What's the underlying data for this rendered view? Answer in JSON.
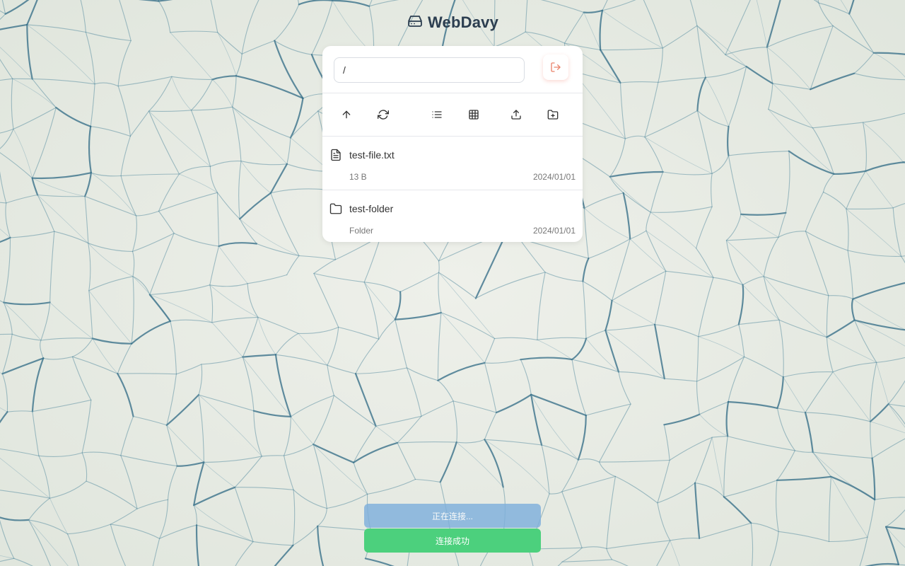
{
  "app": {
    "title": "WebDavy"
  },
  "path_bar": {
    "value": "/"
  },
  "toolbar": {
    "buttons": [
      "arrow-up-icon",
      "refresh-icon",
      "list-view-icon",
      "grid-view-icon",
      "upload-icon",
      "new-folder-icon"
    ]
  },
  "files": [
    {
      "name": "test-file.txt",
      "size": "13 B",
      "date": "2024/01/01",
      "icon": "file-icon"
    },
    {
      "name": "test-folder",
      "size": "Folder",
      "date": "2024/01/01",
      "icon": "folder-icon"
    }
  ],
  "toasts": {
    "connecting": "正在连接...",
    "success": "连接成功"
  },
  "colors": {
    "title": "#2c3e50",
    "logout_accent": "#e9826a",
    "toast_connecting": "#7fb0dc",
    "toast_success": "#4cd07d"
  }
}
